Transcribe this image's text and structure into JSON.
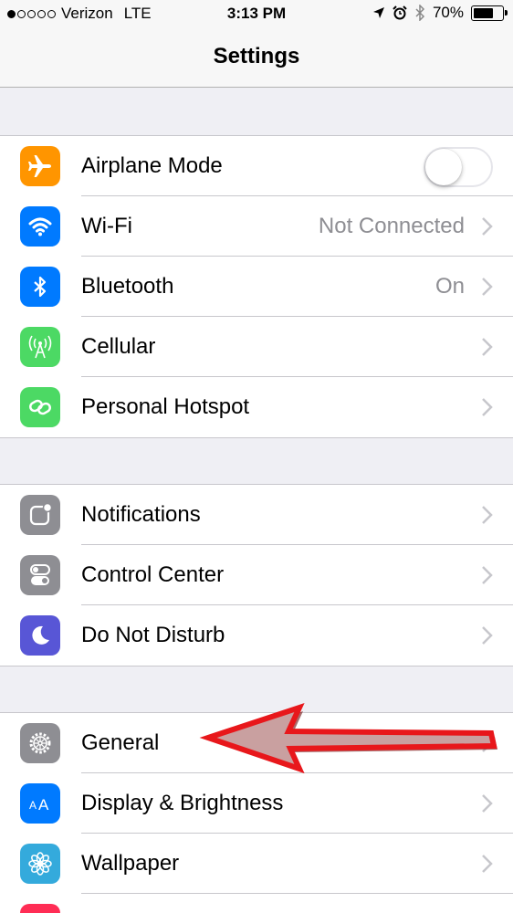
{
  "status_bar": {
    "carrier": "Verizon",
    "network": "LTE",
    "time": "3:13 PM",
    "battery": "70%",
    "battery_level": 0.7
  },
  "nav": {
    "title": "Settings"
  },
  "groups": [
    {
      "items": [
        {
          "id": "airplane-mode",
          "label": "Airplane Mode",
          "icon": "airplane-icon",
          "icon_color": "#ff9500",
          "control": "toggle",
          "toggle_on": false
        },
        {
          "id": "wifi",
          "label": "Wi-Fi",
          "icon": "wifi-icon",
          "icon_color": "#007aff",
          "detail": "Not Connected"
        },
        {
          "id": "bluetooth",
          "label": "Bluetooth",
          "icon": "bluetooth-icon",
          "icon_color": "#007aff",
          "detail": "On"
        },
        {
          "id": "cellular",
          "label": "Cellular",
          "icon": "cellular-icon",
          "icon_color": "#4cd964"
        },
        {
          "id": "personal-hotspot",
          "label": "Personal Hotspot",
          "icon": "hotspot-icon",
          "icon_color": "#4cd964"
        }
      ]
    },
    {
      "items": [
        {
          "id": "notifications",
          "label": "Notifications",
          "icon": "notifications-icon",
          "icon_color": "#8e8e93"
        },
        {
          "id": "control-center",
          "label": "Control Center",
          "icon": "control-center-icon",
          "icon_color": "#8e8e93"
        },
        {
          "id": "do-not-disturb",
          "label": "Do Not Disturb",
          "icon": "moon-icon",
          "icon_color": "#5856d6"
        }
      ]
    },
    {
      "items": [
        {
          "id": "general",
          "label": "General",
          "icon": "gear-icon",
          "icon_color": "#8e8e93"
        },
        {
          "id": "display-brightness",
          "label": "Display & Brightness",
          "icon": "text-size-icon",
          "icon_color": "#007aff"
        },
        {
          "id": "wallpaper",
          "label": "Wallpaper",
          "icon": "flower-icon",
          "icon_color": "#34aadc"
        }
      ]
    }
  ],
  "annotation": {
    "type": "red-arrow",
    "points_to": "general",
    "color": "#e8171b"
  }
}
